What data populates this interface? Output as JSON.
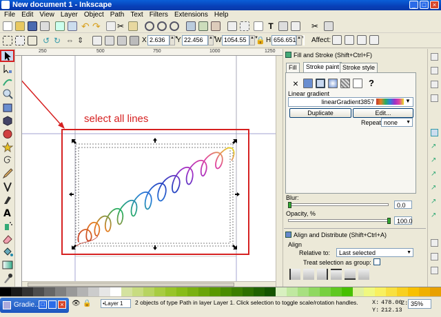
{
  "window": {
    "title": "New document 1 - Inkscape",
    "controls": [
      "_",
      "□",
      "×"
    ]
  },
  "menu": [
    "File",
    "Edit",
    "View",
    "Layer",
    "Object",
    "Path",
    "Text",
    "Filters",
    "Extensions",
    "Help"
  ],
  "select_toolbar": {
    "x_label": "X",
    "x_value": "2.636",
    "y_label": "Y",
    "y_value": "22.456",
    "w_label": "W",
    "w_value": "1054.55",
    "h_label": "H",
    "h_value": "656.651",
    "unit": "px",
    "affect_label": "Affect:"
  },
  "ruler_ticks": [
    "250",
    "500",
    "750",
    "1000",
    "1250"
  ],
  "canvas": {
    "annotation": "select all lines",
    "annotation_color": "#d62020"
  },
  "fill_stroke": {
    "title": "Fill and Stroke (Shift+Ctrl+F)",
    "tabs": [
      "Fill",
      "Stroke paint",
      "Stroke style"
    ],
    "paint_none": "×",
    "paint_unknown": "?",
    "gradient_section": "Linear gradient",
    "gradient_name": "linearGradient3857",
    "duplicate_label": "Duplicate",
    "edit_label": "Edit...",
    "repeat_label": "Repeat:",
    "repeat_value": "none",
    "blur_label": "Blur:",
    "blur_value": "0.0",
    "opacity_label": "Opacity, %",
    "opacity_value": "100.0"
  },
  "align": {
    "title": "Align and Distribute (Shift+Ctrl+A)",
    "section": "Align",
    "relative_label": "Relative to:",
    "relative_value": "Last selected",
    "group_label": "Treat selection as group:"
  },
  "palette": [
    "#000000",
    "#1a1a1a",
    "#333333",
    "#4d4d4d",
    "#666666",
    "#808080",
    "#999999",
    "#b3b3b3",
    "#cccccc",
    "#e6e6e6",
    "#ffffff",
    "#d4e2a0",
    "#c8dc80",
    "#b8d460",
    "#a8cc40",
    "#98c428",
    "#88bc18",
    "#7ab010",
    "#6aa408",
    "#5a9800",
    "#4a8c00",
    "#3c7e00",
    "#2e7000",
    "#206200",
    "#145400",
    "#d8f0c0",
    "#c0e8a0",
    "#a8e080",
    "#90d860",
    "#78d040",
    "#60c820",
    "#48c000",
    "#e0f0a0",
    "#f0f880",
    "#f8f060",
    "#f8e040",
    "#f8d020",
    "#f8c000",
    "#f0b000",
    "#e8a000"
  ],
  "status": {
    "taskbar_label": "Gradie...",
    "layer": "•Layer 1",
    "message": "2 objects of type Path in layer Layer 1. Click selection to toggle scale/rotation handles.",
    "x_label": "X:",
    "x_value": "478.00",
    "y_label": "Y:",
    "y_value": "212.13",
    "z_label": "Z:",
    "zoom": "35%"
  }
}
